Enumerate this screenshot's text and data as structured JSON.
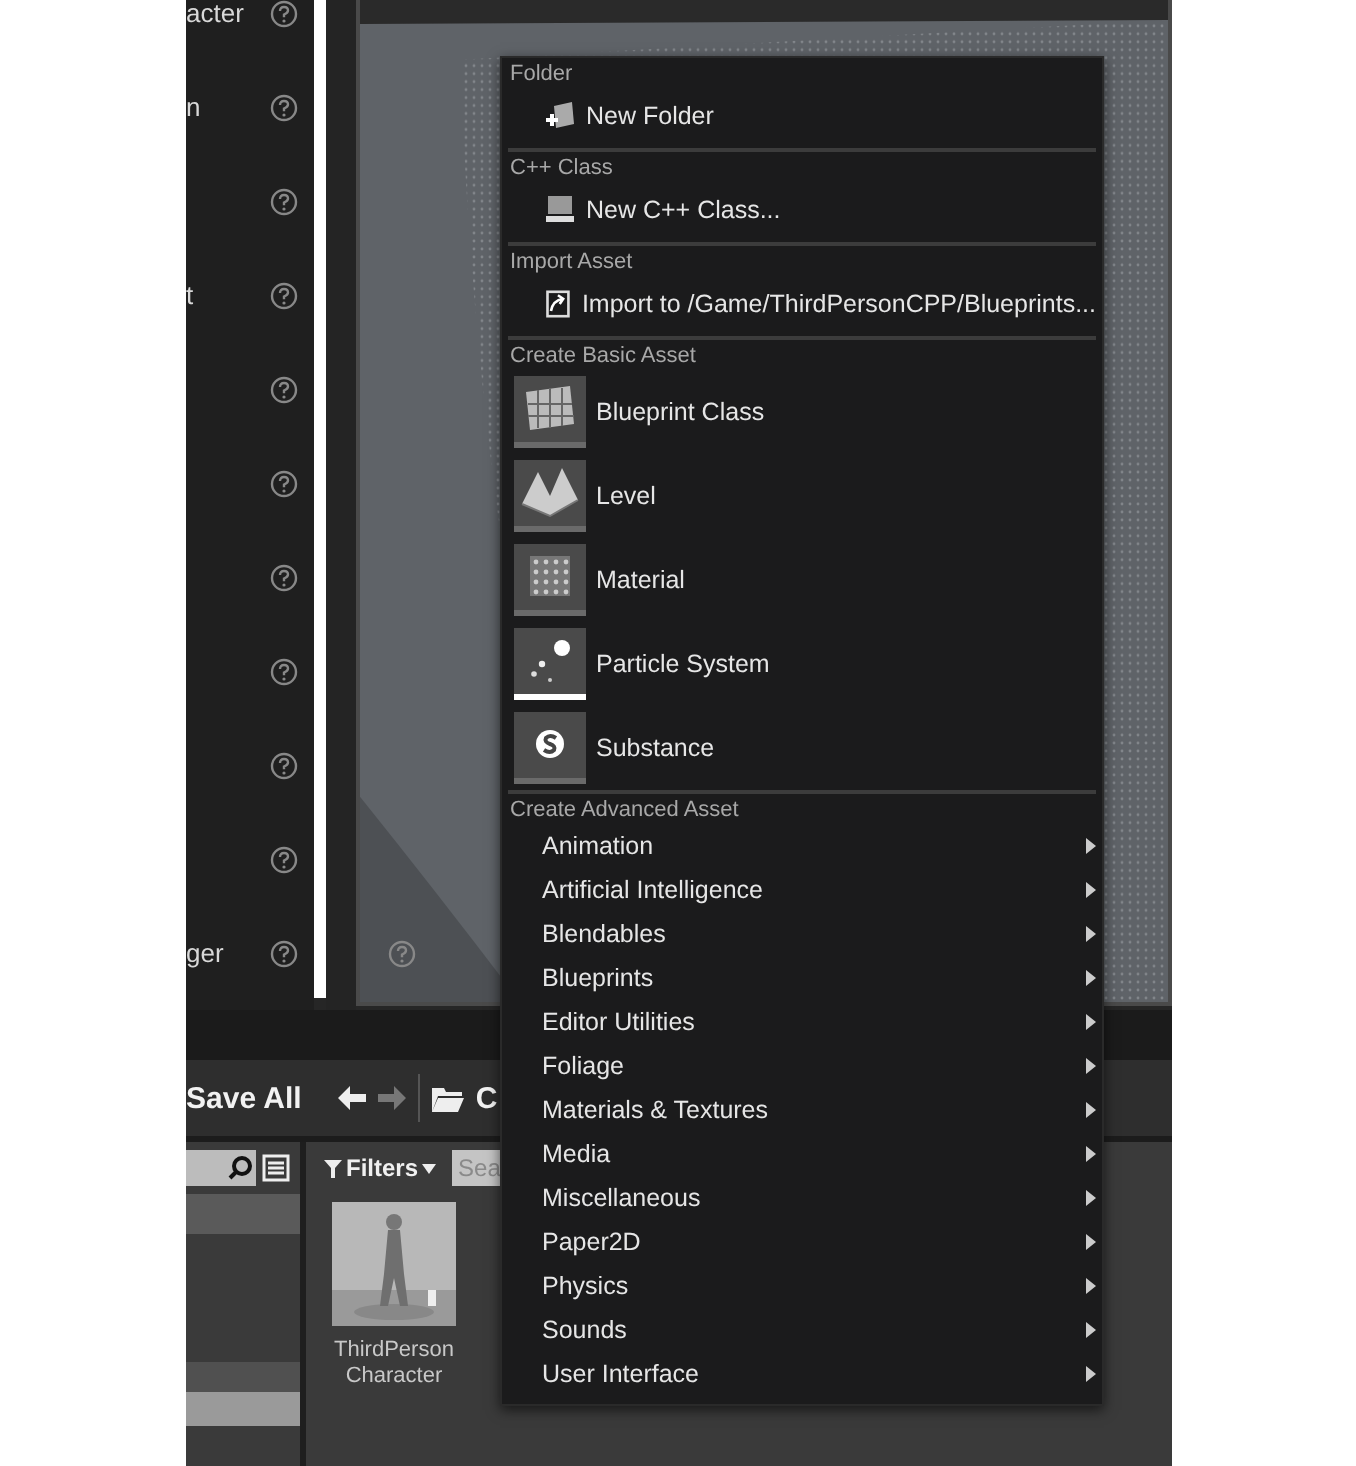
{
  "details_panel": {
    "rows": [
      {
        "label": "acter"
      },
      {
        "label": "n"
      },
      {},
      {
        "label": "t"
      },
      {},
      {},
      {},
      {},
      {},
      {},
      {
        "label": "ger"
      }
    ]
  },
  "toolbar": {
    "save_all": "Save All",
    "path": "C"
  },
  "content_browser": {
    "filters": "Filters",
    "search": {
      "placeholder": "Sea"
    },
    "assets": [
      {
        "name": "ThirdPerson Character"
      }
    ]
  },
  "context_menu": {
    "sections": [
      {
        "header": "Folder",
        "items": [
          {
            "kind": "small",
            "label": "New Folder"
          }
        ]
      },
      {
        "header": "C++ Class",
        "items": [
          {
            "kind": "small",
            "label": "New C++ Class..."
          }
        ]
      },
      {
        "header": "Import Asset",
        "items": [
          {
            "kind": "small",
            "label": "Import to /Game/ThirdPersonCPP/Blueprints..."
          }
        ]
      },
      {
        "header": "Create Basic Asset",
        "items": [
          {
            "kind": "large",
            "label": "Blueprint Class",
            "color": "#6a6a6a"
          },
          {
            "kind": "large",
            "label": "Level",
            "color": "#6a6a6a"
          },
          {
            "kind": "large",
            "label": "Material",
            "color": "#6a6a6a"
          },
          {
            "kind": "large",
            "label": "Particle System",
            "color": "#ffffff"
          },
          {
            "kind": "large",
            "label": "Substance",
            "color": "#6a6a6a"
          }
        ]
      },
      {
        "header": "Create Advanced Asset",
        "items": [
          {
            "kind": "submenu",
            "label": "Animation"
          },
          {
            "kind": "submenu",
            "label": "Artificial Intelligence"
          },
          {
            "kind": "submenu",
            "label": "Blendables"
          },
          {
            "kind": "submenu",
            "label": "Blueprints"
          },
          {
            "kind": "submenu",
            "label": "Editor Utilities"
          },
          {
            "kind": "submenu",
            "label": "Foliage"
          },
          {
            "kind": "submenu",
            "label": "Materials & Textures"
          },
          {
            "kind": "submenu",
            "label": "Media"
          },
          {
            "kind": "submenu",
            "label": "Miscellaneous"
          },
          {
            "kind": "submenu",
            "label": "Paper2D"
          },
          {
            "kind": "submenu",
            "label": "Physics"
          },
          {
            "kind": "submenu",
            "label": "Sounds"
          },
          {
            "kind": "submenu",
            "label": "User Interface"
          }
        ]
      }
    ]
  }
}
